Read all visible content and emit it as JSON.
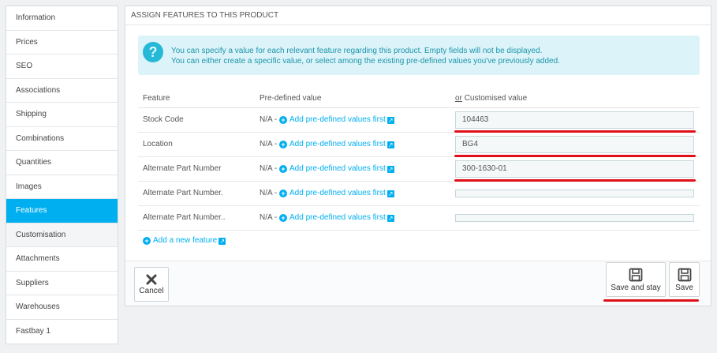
{
  "sidebar": {
    "items": [
      {
        "label": "Information"
      },
      {
        "label": "Prices"
      },
      {
        "label": "SEO"
      },
      {
        "label": "Associations"
      },
      {
        "label": "Shipping"
      },
      {
        "label": "Combinations"
      },
      {
        "label": "Quantities"
      },
      {
        "label": "Images"
      },
      {
        "label": "Features"
      },
      {
        "label": "Customisation"
      },
      {
        "label": "Attachments"
      },
      {
        "label": "Suppliers"
      },
      {
        "label": "Warehouses"
      },
      {
        "label": "Fastbay 1"
      }
    ]
  },
  "panel": {
    "title": "ASSIGN FEATURES TO THIS PRODUCT",
    "alert_line1": "You can specify a value for each relevant feature regarding this product. Empty fields will not be displayed.",
    "alert_line2": "You can either create a specific value, or select among the existing pre-defined values you've previously added."
  },
  "table": {
    "headers": {
      "feature": "Feature",
      "predefined": "Pre-defined value",
      "or": "or",
      "customised": "Customised value"
    },
    "na_text": "N/A -",
    "add_predefined": "Add pre-defined values first",
    "rows": [
      {
        "feature": "Stock Code",
        "value": "104463"
      },
      {
        "feature": "Location",
        "value": "BG4"
      },
      {
        "feature": "Alternate Part Number",
        "value": "300-1630-01"
      },
      {
        "feature": "Alternate Part Number.",
        "value": ""
      },
      {
        "feature": "Alternate Part Number..",
        "value": ""
      }
    ],
    "add_new_feature": "Add a new feature"
  },
  "footer": {
    "cancel_label": "Cancel",
    "save_stay_label": "Save and stay",
    "save_label": "Save"
  },
  "colors": {
    "accent": "#00aff0",
    "highlight": "#e0101a",
    "alert_bg": "#dcf4f9"
  }
}
